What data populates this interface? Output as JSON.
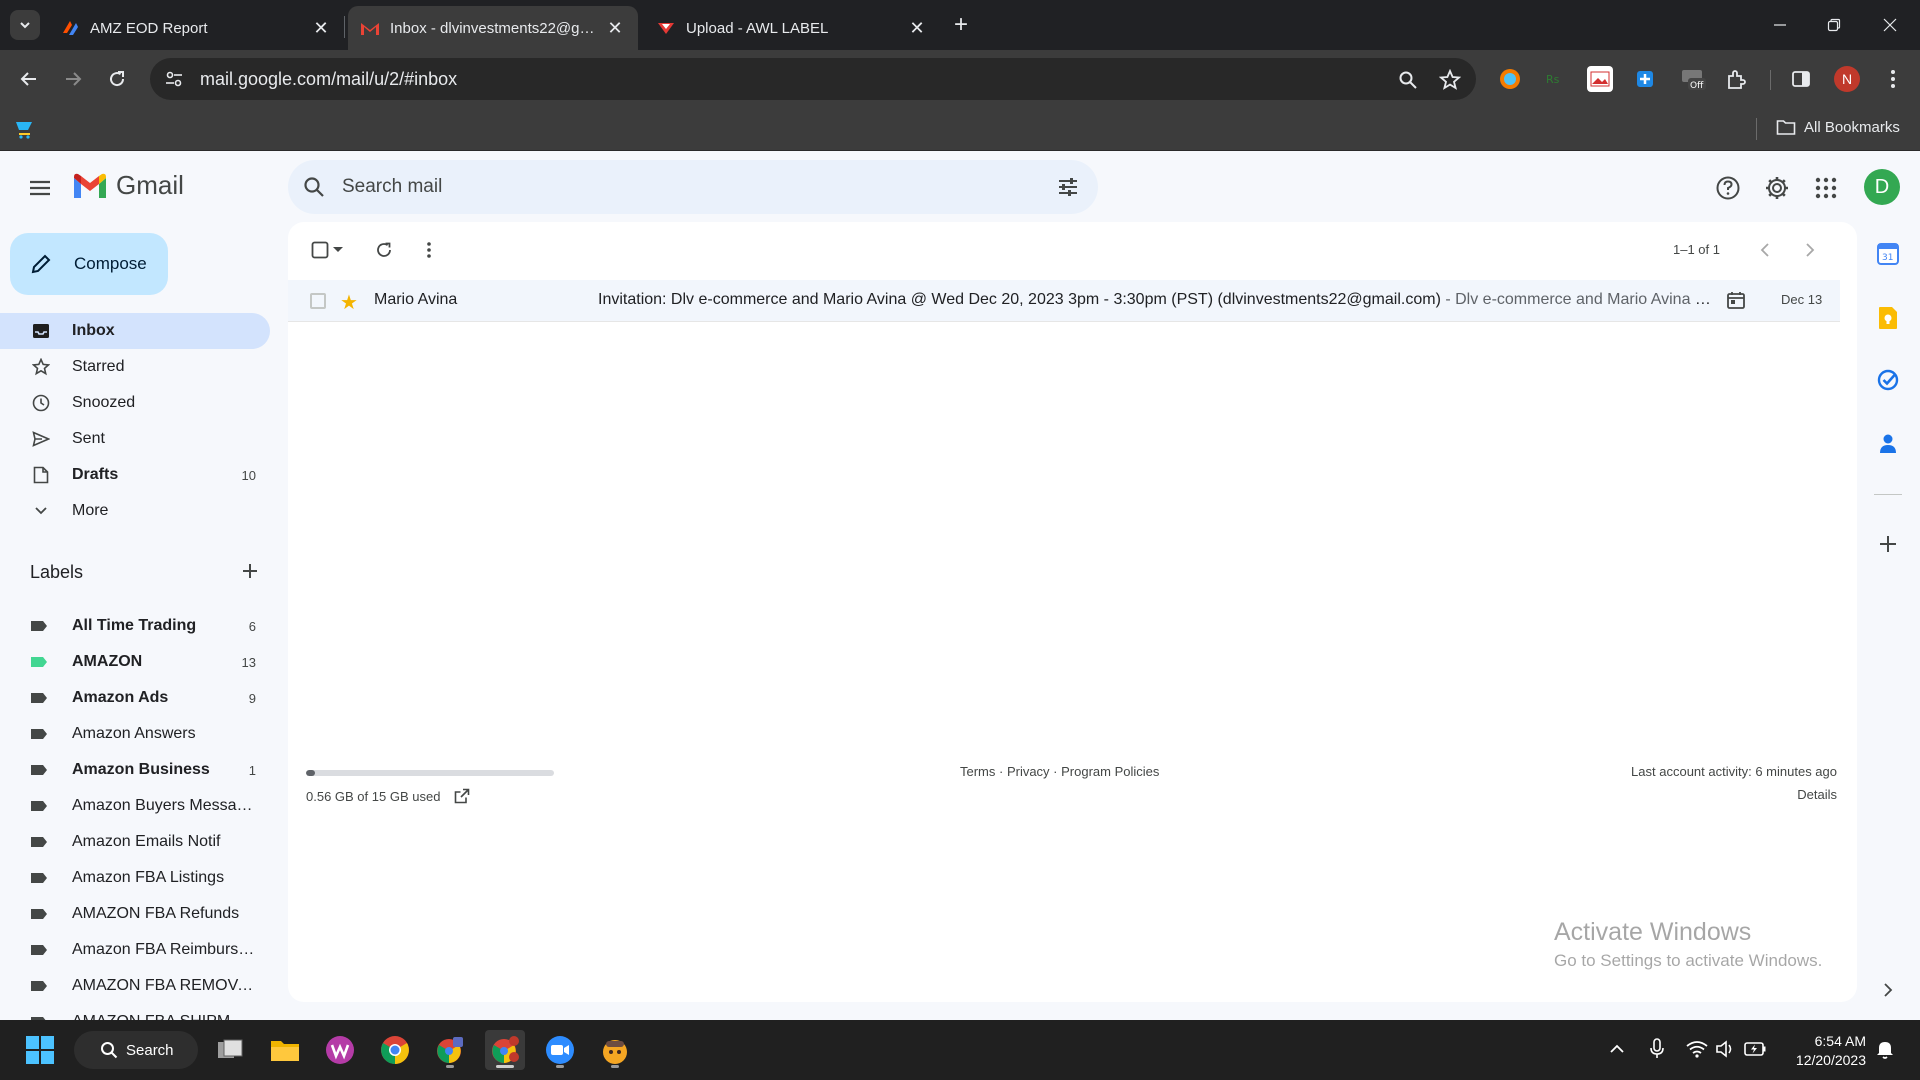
{
  "browser": {
    "tabs": [
      {
        "title": "AMZ EOD Report",
        "active": false
      },
      {
        "title": "Inbox - dlvinvestments22@gmail.com",
        "active": true
      },
      {
        "title": "Upload - AWL LABEL",
        "active": false
      }
    ],
    "url": "mail.google.com/mail/u/2/#inbox",
    "profile_initial": "N",
    "bookmarks_label": "All Bookmarks"
  },
  "gmail": {
    "logo_text": "Gmail",
    "search_placeholder": "Search mail",
    "account_initial": "D",
    "compose_label": "Compose",
    "nav": [
      {
        "label": "Inbox",
        "count": "",
        "icon": "inbox-icon"
      },
      {
        "label": "Starred",
        "count": "",
        "icon": "star-icon"
      },
      {
        "label": "Snoozed",
        "count": "",
        "icon": "clock-icon"
      },
      {
        "label": "Sent",
        "count": "",
        "icon": "send-icon"
      },
      {
        "label": "Drafts",
        "count": "10",
        "icon": "draft-icon"
      },
      {
        "label": "More",
        "count": "",
        "icon": "chevron-down-icon"
      }
    ],
    "labels_title": "Labels",
    "labels": [
      {
        "label": "All Time Trading",
        "count": "6",
        "bold": true,
        "color": "#444746"
      },
      {
        "label": "AMAZON",
        "count": "13",
        "bold": true,
        "color": "#42d692"
      },
      {
        "label": "Amazon Ads",
        "count": "9",
        "bold": true,
        "color": "#444746"
      },
      {
        "label": "Amazon Answers",
        "count": "",
        "bold": false,
        "color": "#444746"
      },
      {
        "label": "Amazon Business",
        "count": "1",
        "bold": true,
        "color": "#444746"
      },
      {
        "label": "Amazon Buyers Messages",
        "count": "",
        "bold": false,
        "color": "#444746"
      },
      {
        "label": "Amazon Emails Notif",
        "count": "",
        "bold": false,
        "color": "#444746"
      },
      {
        "label": "Amazon FBA Listings",
        "count": "",
        "bold": false,
        "color": "#444746"
      },
      {
        "label": "AMAZON FBA Refunds",
        "count": "",
        "bold": false,
        "color": "#444746"
      },
      {
        "label": "Amazon FBA Reimbursements",
        "count": "",
        "bold": false,
        "color": "#444746"
      },
      {
        "label": "AMAZON FBA REMOVAL",
        "count": "",
        "bold": false,
        "color": "#444746"
      },
      {
        "label": "AMAZON FBA SHIPMENTS",
        "count": "",
        "bold": false,
        "color": "#444746"
      }
    ],
    "pager": "1–1 of 1",
    "emails": [
      {
        "sender": "Mario Avina",
        "starred": true,
        "subject": "Invitation: Dlv e-commerce and Mario Avina @ Wed Dec 20, 2023 3pm - 3:30pm (PST) (dlvinvestments22@gmail.com)",
        "snippet": " - Dlv e-commerce and Mario Avina Event",
        "date": "Dec 13"
      }
    ],
    "storage": {
      "text": "0.56 GB of 15 GB used",
      "used_fraction": 0.037
    },
    "footer_links": "Terms · Privacy · Program Policies",
    "last_activity": "Last account activity: 6 minutes ago",
    "details_label": "Details"
  },
  "watermark": {
    "line1": "Activate Windows",
    "line2": "Go to Settings to activate Windows."
  },
  "taskbar": {
    "search_label": "Search",
    "time": "6:54 AM",
    "date": "12/20/2023"
  }
}
